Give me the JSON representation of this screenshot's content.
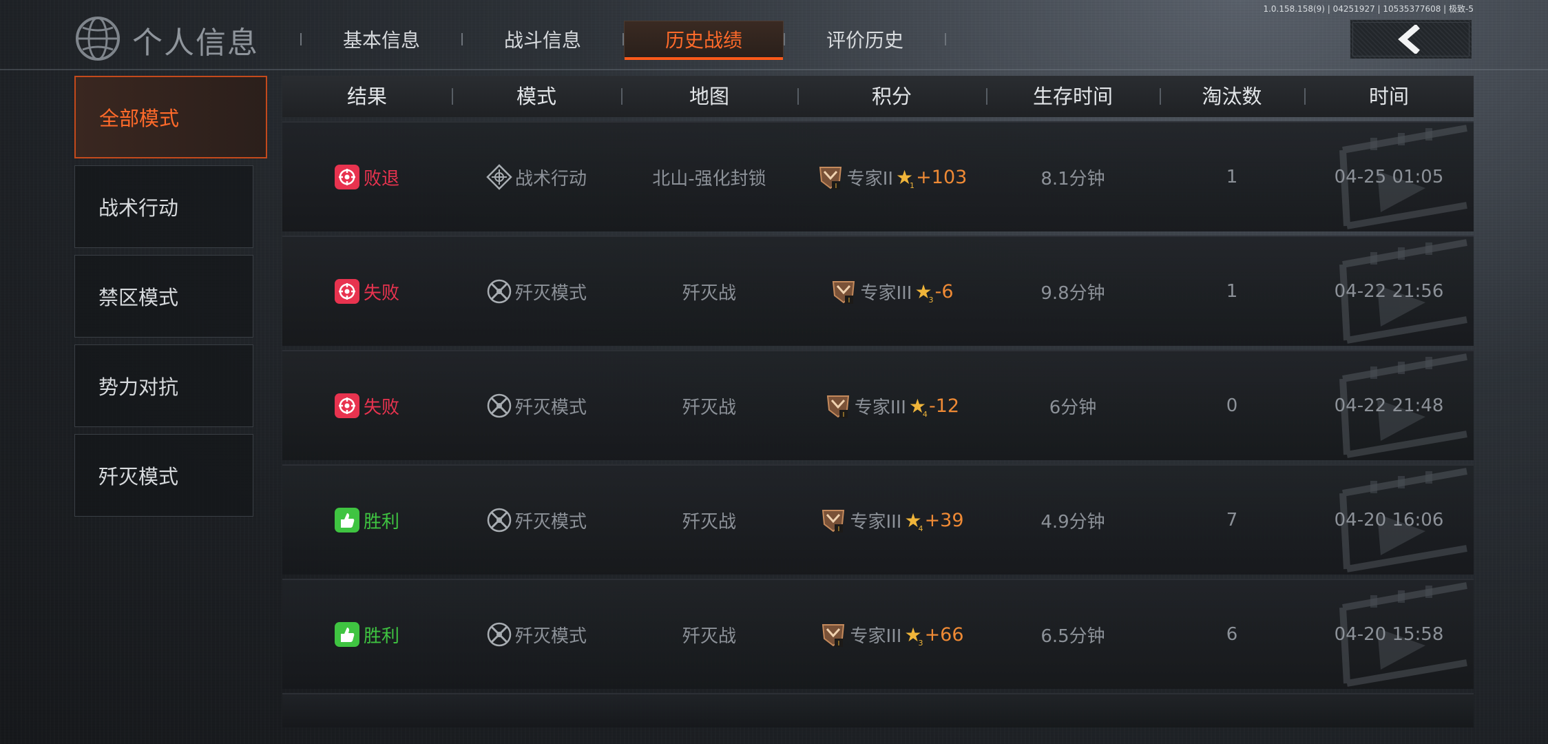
{
  "version": "1.0.158.158(9) | 04251927 | 10535377608 | 极致-5",
  "header": {
    "title": "个人信息",
    "tabs": [
      {
        "label": "基本信息",
        "active": false
      },
      {
        "label": "战斗信息",
        "active": false
      },
      {
        "label": "历史战绩",
        "active": true
      },
      {
        "label": "评价历史",
        "active": false
      }
    ],
    "back_icon": "chevron-left-icon"
  },
  "sidebar": {
    "items": [
      {
        "label": "全部模式",
        "active": true
      },
      {
        "label": "战术行动",
        "active": false
      },
      {
        "label": "禁区模式",
        "active": false
      },
      {
        "label": "势力对抗",
        "active": false
      },
      {
        "label": "歼灭模式",
        "active": false
      }
    ]
  },
  "table": {
    "columns": [
      "结果",
      "模式",
      "地图",
      "积分",
      "生存时间",
      "淘汰数",
      "时间"
    ],
    "rows": [
      {
        "result": "败退",
        "result_type": "loss",
        "mode": "战术行动",
        "mode_icon": "diamond-crosshair-icon",
        "map": "北山-强化封锁",
        "rank": "专家II",
        "stars": "1",
        "score": "+103",
        "survival": "8.1分钟",
        "kills": "1",
        "time": "04-25 01:05"
      },
      {
        "result": "失败",
        "result_type": "loss",
        "mode": "歼灭模式",
        "mode_icon": "crossed-rifles-icon",
        "map": "歼灭战",
        "rank": "专家III",
        "stars": "3",
        "score": "-6",
        "survival": "9.8分钟",
        "kills": "1",
        "time": "04-22 21:56"
      },
      {
        "result": "失败",
        "result_type": "loss",
        "mode": "歼灭模式",
        "mode_icon": "crossed-rifles-icon",
        "map": "歼灭战",
        "rank": "专家III",
        "stars": "4",
        "score": "-12",
        "survival": "6分钟",
        "kills": "0",
        "time": "04-22 21:48"
      },
      {
        "result": "胜利",
        "result_type": "win",
        "mode": "歼灭模式",
        "mode_icon": "crossed-rifles-icon",
        "map": "歼灭战",
        "rank": "专家III",
        "stars": "4",
        "score": "+39",
        "survival": "4.9分钟",
        "kills": "7",
        "time": "04-20 16:06"
      },
      {
        "result": "胜利",
        "result_type": "win",
        "mode": "歼灭模式",
        "mode_icon": "crossed-rifles-icon",
        "map": "歼灭战",
        "rank": "专家III",
        "stars": "3",
        "score": "+66",
        "survival": "6.5分钟",
        "kills": "6",
        "time": "04-20 15:58"
      }
    ]
  },
  "colors": {
    "accent": "#ff6a2a",
    "loss": "#e8334f",
    "win": "#3fc441",
    "score": "#ef8a35",
    "star": "#f0b53a"
  }
}
